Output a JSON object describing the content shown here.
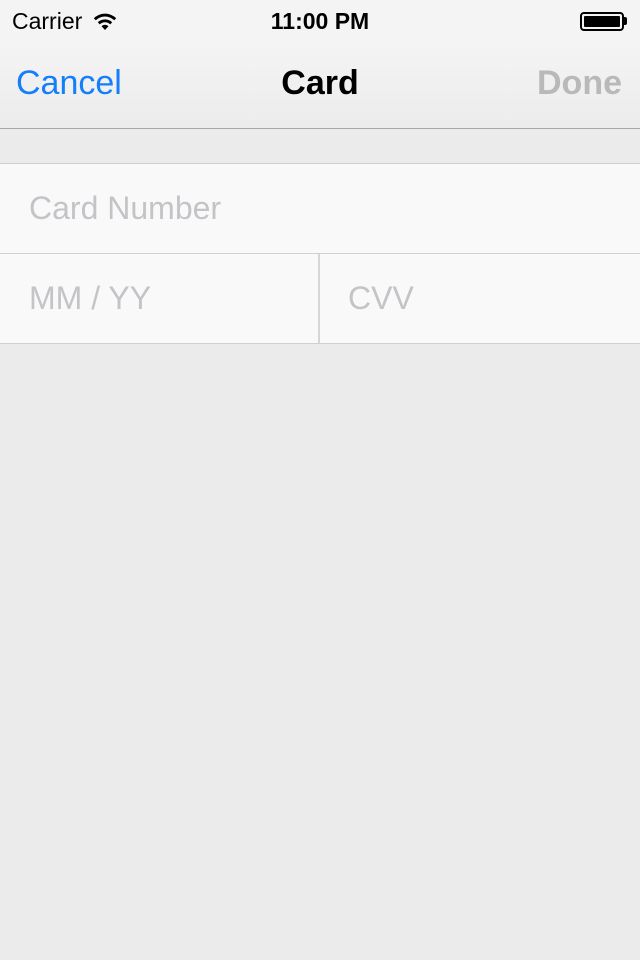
{
  "status_bar": {
    "carrier": "Carrier",
    "time": "11:00 PM",
    "icons": [
      "wifi-icon",
      "battery-icon"
    ]
  },
  "nav": {
    "cancel_label": "Cancel",
    "title": "Card",
    "done_label": "Done",
    "cancel_color": "#147efb",
    "done_color": "#b9b9b9"
  },
  "form": {
    "card_number": {
      "value": "",
      "placeholder": "Card Number"
    },
    "expiry": {
      "value": "",
      "placeholder": "MM / YY"
    },
    "cvv": {
      "value": "",
      "placeholder": "CVV"
    }
  }
}
